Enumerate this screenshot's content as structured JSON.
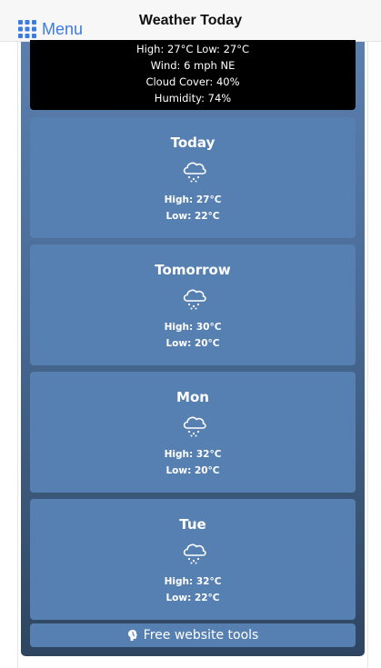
{
  "header": {
    "menu_label": "Menu",
    "title": "Weather Today"
  },
  "current": {
    "high_low": "High: 27°C Low: 27°C",
    "wind": "Wind: 6 mph NE",
    "cloud_cover": "Cloud Cover: 40%",
    "humidity": "Humidity: 74%"
  },
  "forecast": [
    {
      "day": "Today",
      "icon": "rain-cloud-icon",
      "high": "High: 27°C",
      "low": "Low: 22°C"
    },
    {
      "day": "Tomorrow",
      "icon": "rain-cloud-icon",
      "high": "High: 30°C",
      "low": "Low: 20°C"
    },
    {
      "day": "Mon",
      "icon": "rain-cloud-icon",
      "high": "High: 32°C",
      "low": "Low: 20°C"
    },
    {
      "day": "Tue",
      "icon": "rain-cloud-icon",
      "high": "High: 32°C",
      "low": "Low: 22°C"
    }
  ],
  "footer": {
    "label": "Free website tools",
    "icon": "brain-icon"
  },
  "colors": {
    "accent": "#3d7be0",
    "card": "#5780b2",
    "current_bg": "#000000"
  }
}
